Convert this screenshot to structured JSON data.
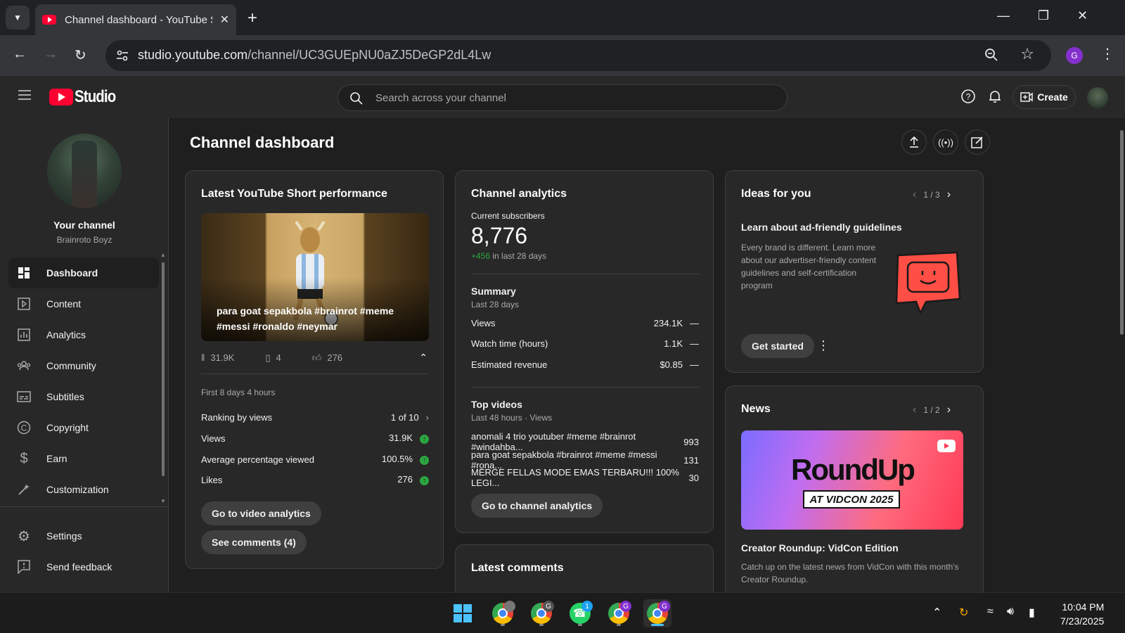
{
  "browser": {
    "tab_title": "Channel dashboard - YouTube Studio",
    "url_host": "studio.youtube.com",
    "url_path": "/channel/UC3GUEpNU0aZJ5DeGP2dL4Lw",
    "profile_letter": "G"
  },
  "header": {
    "logo_text": "Studio",
    "search_placeholder": "Search across your channel",
    "create_label": "Create"
  },
  "sidebar": {
    "your_channel": "Your channel",
    "channel_name": "Brainroto Boyz",
    "items": [
      {
        "label": "Dashboard",
        "icon": "dashboard-icon",
        "active": true
      },
      {
        "label": "Content",
        "icon": "content-icon"
      },
      {
        "label": "Analytics",
        "icon": "analytics-icon"
      },
      {
        "label": "Community",
        "icon": "community-icon"
      },
      {
        "label": "Subtitles",
        "icon": "subtitles-icon"
      },
      {
        "label": "Copyright",
        "icon": "copyright-icon"
      },
      {
        "label": "Earn",
        "icon": "dollar-icon"
      },
      {
        "label": "Customization",
        "icon": "magic-wand-icon"
      }
    ],
    "bottom_items": [
      {
        "label": "Settings",
        "icon": "gear-icon"
      },
      {
        "label": "Send feedback",
        "icon": "feedback-icon"
      }
    ]
  },
  "main": {
    "page_title": "Channel dashboard",
    "short_card": {
      "title": "Latest YouTube Short performance",
      "caption": "para goat sepakbola #brainrot #meme #messi #ronaldo #neymar",
      "views": "31.9K",
      "comments": "4",
      "likes": "276",
      "period": "First 8 days 4 hours",
      "ranking_label": "Ranking by views",
      "ranking_value": "1 of 10",
      "rows": [
        {
          "label": "Views",
          "value": "31.9K"
        },
        {
          "label": "Average percentage viewed",
          "value": "100.5%"
        },
        {
          "label": "Likes",
          "value": "276"
        }
      ],
      "btn_video_analytics": "Go to video analytics",
      "btn_comments": "See comments (4)"
    },
    "analytics_card": {
      "title": "Channel analytics",
      "subs_label": "Current subscribers",
      "subs_value": "8,776",
      "subs_change": "+456",
      "subs_change_period": " in last 28 days",
      "summary_title": "Summary",
      "summary_period": "Last 28 days",
      "summary_rows": [
        {
          "label": "Views",
          "value": "234.1K",
          "trend": "—"
        },
        {
          "label": "Watch time (hours)",
          "value": "1.1K",
          "trend": "—"
        },
        {
          "label": "Estimated revenue",
          "value": "$0.85",
          "trend": "—"
        }
      ],
      "top_title": "Top videos",
      "top_period": "Last 48 hours · Views",
      "top_videos": [
        {
          "title": "anomali 4 trio youtuber #meme #brainrot #windahba...",
          "views": "993"
        },
        {
          "title": "para goat sepakbola #brainrot #meme #messi #rona...",
          "views": "131"
        },
        {
          "title": "MERGE FELLAS MODE EMAS TERBARU!!! 100% LEGI...",
          "views": "30"
        }
      ],
      "btn_channel_analytics": "Go to channel analytics"
    },
    "comments_card": {
      "title": "Latest comments"
    },
    "ideas_card": {
      "title": "Ideas for you",
      "pager": "1 / 3",
      "idea_title": "Learn about ad-friendly guidelines",
      "idea_body": "Every brand is different. Learn more about our advertiser-friendly content guidelines and self-certification program",
      "btn_get_started": "Get started"
    },
    "news_card": {
      "title": "News",
      "pager": "1 / 2",
      "image_text": "RoundUp",
      "image_subtext": "AT VIDCON 2025",
      "news_title": "Creator Roundup: VidCon Edition",
      "news_body": "Catch up on the latest news from VidCon with this month's Creator Roundup."
    }
  },
  "taskbar": {
    "time": "10:04 PM",
    "date": "7/23/2025",
    "whatsapp_badge": "1",
    "chrome_badges": [
      "G",
      "G",
      "G"
    ]
  },
  "colors": {
    "youtube_red": "#ff0033",
    "positive_green": "#2ba640",
    "surface": "#282828",
    "background": "#1f1f1f"
  }
}
